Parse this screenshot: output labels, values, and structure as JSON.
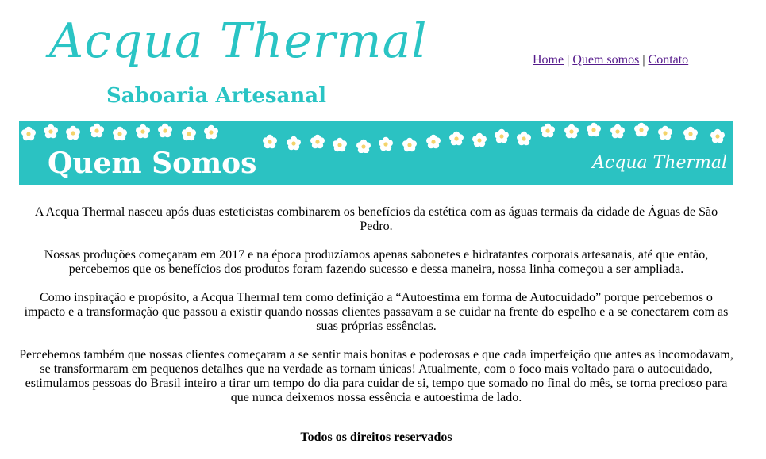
{
  "header": {
    "logo_text": "Acqua Thermal",
    "subtitle": "Saboaria Artesanal"
  },
  "nav": {
    "home": "Home",
    "about": "Quem somos",
    "contact": "Contato",
    "separator": "|"
  },
  "banner": {
    "title": "Quem Somos",
    "brand": "Acqua Thermal"
  },
  "content": {
    "paragraphs": [
      "A Acqua Thermal nasceu após duas esteticistas combinarem os benefícios da estética com as águas termais da cidade de Águas de São Pedro.",
      "Nossas produções começaram em 2017 e na época produzíamos apenas sabonetes e hidratantes corporais artesanais, até que então, percebemos que os benefícios dos produtos foram fazendo sucesso e dessa maneira, nossa linha começou a ser ampliada.",
      "Como inspiração e propósito, a Acqua Thermal tem como definição a “Autoestima em forma de Autocuidado” porque percebemos o impacto e a transformação que passou a existir quando nossas clientes passavam a se cuidar na frente do espelho e a se conectarem com as suas próprias essências.",
      "Percebemos também que nossas clientes começaram a se sentir mais bonitas e poderosas e que cada imperfeição que antes as incomodavam, se transformaram em pequenos detalhes que na verdade as tornam únicas! Atualmente, com o foco mais voltado para o autocuidado, estimulamos pessoas do Brasil inteiro a tirar um tempo do dia para cuidar de si, tempo que somado no final do mês, se torna precioso para que nunca deixemos nossa essência e autoestima de lado."
    ]
  },
  "footer": {
    "text": "Todos os direitos reservados"
  },
  "colors": {
    "brand": "#2ac4c4",
    "banner_bg": "#2bc2c2",
    "link": "#551a8b"
  }
}
